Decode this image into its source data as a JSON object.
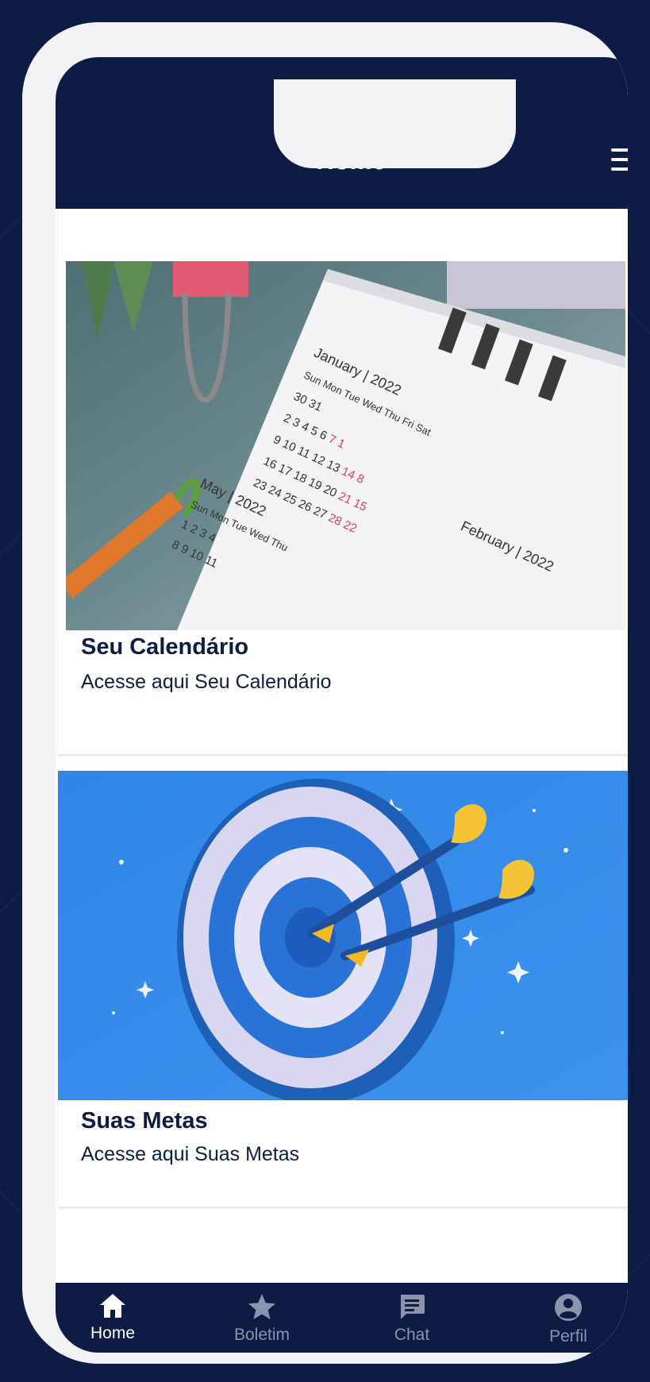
{
  "header": {
    "title": "Home",
    "menu_icon": "hamburger-menu-icon"
  },
  "cards": [
    {
      "title": "Seu Calendário",
      "subtitle": "Acesse aqui Seu Calendário",
      "image": {
        "months": [
          "January",
          "February",
          "May"
        ],
        "year": "2022",
        "weekdays": [
          "Sun",
          "Mon",
          "Tue",
          "Wed",
          "Thu",
          "Fri",
          "Sat"
        ]
      }
    },
    {
      "title": "Suas Metas",
      "subtitle": "Acesse aqui Suas Metas",
      "image": {
        "subject": "target-with-arrows-illustration"
      }
    }
  ],
  "tabbar": {
    "items": [
      {
        "label": "Home",
        "icon": "home-icon",
        "active": true
      },
      {
        "label": "Boletim",
        "icon": "star-icon",
        "active": false
      },
      {
        "label": "Chat",
        "icon": "chat-icon",
        "active": false
      },
      {
        "label": "Perfil",
        "icon": "profile-icon",
        "active": false
      }
    ]
  },
  "colors": {
    "navy": "#0d1b45",
    "inactive_tab": "#8b93ad",
    "target_blue": "#2e7fe0"
  }
}
